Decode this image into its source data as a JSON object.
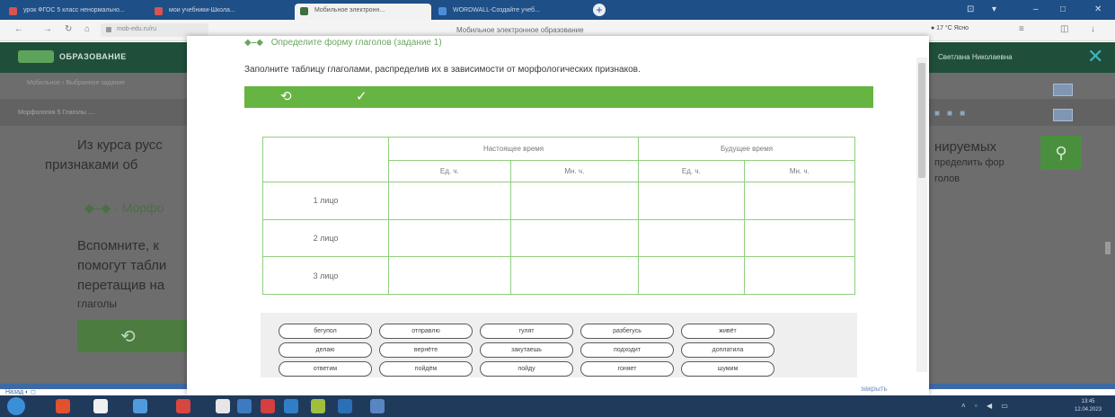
{
  "browser": {
    "tabs": [
      {
        "label": "урок ФГОС 5 класс ненормально..."
      },
      {
        "label": "мои учебники-Школа..."
      },
      {
        "label": "Мобильное электронн..."
      },
      {
        "label": "WORDWALL-Создайте учеб..."
      }
    ],
    "new_tab": "+",
    "window_controls": [
      "⊡",
      "▾",
      "–",
      "□",
      "✕"
    ],
    "back": "←",
    "forward": "→",
    "reload": "↻",
    "home": "⌂",
    "url": "mob-edu.ru/ru",
    "page_title": "Мобильное электронное образование",
    "extension_text": "● 17 °C Ясно",
    "menu_icon": "≡",
    "download_icon": "↓"
  },
  "site": {
    "logo": "ОБРАЗОВАНИЕ",
    "user": "Светлана Николаевна",
    "breadcrumbs": "Мобильное  ›  Выбранное задание",
    "subheader": "Морфология 5 Глаголы ....",
    "bg_line1": "Из курса русс",
    "bg_line2": "признаками об",
    "bg_right1": "нируемых",
    "bg_right2": "пределить фор",
    "bg_right3": "голов",
    "bg_section": "Морфо",
    "bg_para1": "Вспомните, к",
    "bg_para2": "помогут табли",
    "bg_para3": "перетащив на",
    "bg_para4": "глаголы",
    "bottom_label": "Назад  ◐  ◻"
  },
  "modal": {
    "task_link_prefix": "◆–◆",
    "task_link": "Определите форму глаголов (задание 1)",
    "instruction": "Заполните таблицу глаголами, распределив их в зависимости от морфологических признаков.",
    "toolbar": {
      "reset_icon": "⟲",
      "check_icon": "✓"
    },
    "table": {
      "groups": [
        "Настоящее время",
        "Будущее время"
      ],
      "sub_headers": [
        "Ед. ч.",
        "Мн. ч.",
        "Ед. ч.",
        "Мн. ч."
      ],
      "rows": [
        "1 лицо",
        "2 лицо",
        "3 лицо"
      ]
    },
    "word_bank": [
      "бегупол",
      "отправлю",
      "гулят",
      "разбегусь",
      "живёт",
      "делаю",
      "вернёте",
      "закутаешь",
      "подходит",
      "доплатила",
      "ответим",
      "пойдём",
      "пойду",
      "гоняет",
      "шумим"
    ],
    "send_label": "закрыть"
  },
  "taskbar": {
    "clock_time": "13:45",
    "clock_date": "12.04.2023",
    "tray": "˄ ▫ ◀ ▭"
  },
  "colors": {
    "accent_green": "#66b442",
    "table_border": "#8fcf7f",
    "site_header": "#1f4f3a",
    "browser_chrome": "#1e4f86"
  }
}
